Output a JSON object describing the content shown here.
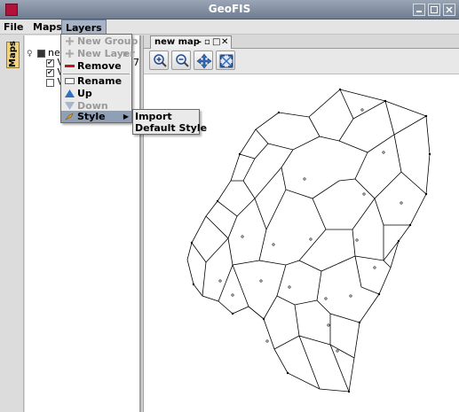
{
  "window": {
    "title": "GeoFIS"
  },
  "menubar": {
    "items": [
      {
        "label": "File"
      },
      {
        "label": "Maps"
      },
      {
        "label": "Layers"
      }
    ]
  },
  "sidebar": {
    "tab_label": "Maps"
  },
  "tree": {
    "root_label": "new",
    "layers": [
      {
        "label": "V",
        "checked": true,
        "suffix": "7"
      },
      {
        "label": "V",
        "checked": true
      },
      {
        "label": "V",
        "checked": false
      }
    ]
  },
  "doc_tab": {
    "label": "new map"
  },
  "toolbar": {
    "buttons": [
      "zoom-in-icon",
      "zoom-out-icon",
      "pan-icon",
      "zoom-extent-icon"
    ]
  },
  "layers_menu": {
    "items": [
      {
        "label": "New Group",
        "enabled": false,
        "icon": "plus-icon"
      },
      {
        "label": "New Layer",
        "enabled": false,
        "icon": "plus-icon",
        "submenu": true
      },
      {
        "label": "Remove",
        "enabled": true,
        "icon": "remove-icon"
      },
      {
        "label": "Rename",
        "enabled": true,
        "icon": "rename-icon"
      },
      {
        "label": "Up",
        "enabled": true,
        "icon": "up-arrow-icon"
      },
      {
        "label": "Down",
        "enabled": false,
        "icon": "down-arrow-icon"
      },
      {
        "label": "Style",
        "enabled": true,
        "icon": "style-icon",
        "submenu": true,
        "highlighted": true
      }
    ]
  },
  "style_submenu": {
    "items": [
      {
        "label": "Import"
      },
      {
        "label": "Default Style"
      }
    ]
  },
  "colors": {
    "accent": "#8f9fb6",
    "titlebar": "#6f7c8f",
    "app_icon": "#b0123a"
  }
}
